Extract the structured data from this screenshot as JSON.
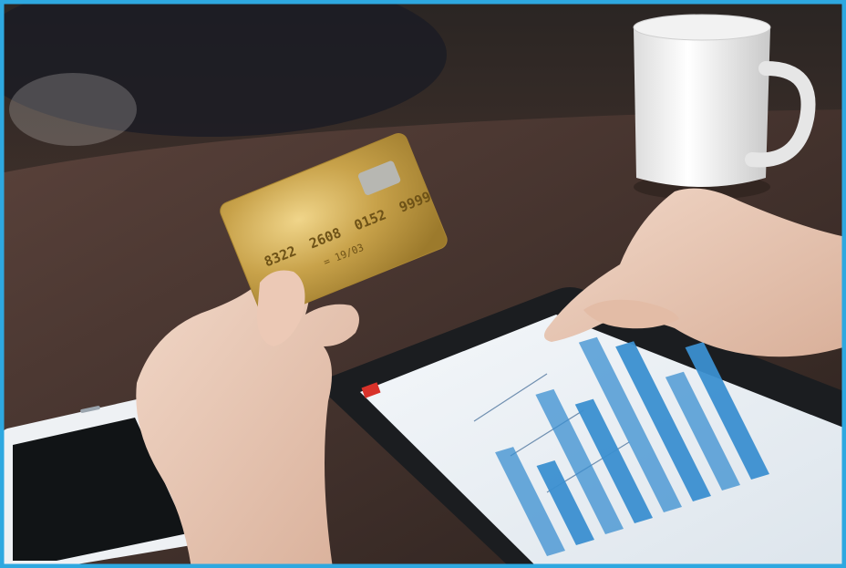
{
  "photo": {
    "frame_color": "#2ea8e0",
    "card": {
      "number_groups": [
        "8322",
        "2608",
        "0152",
        "9999"
      ],
      "expiry_label": "= 19/03",
      "color": "#c8a24a"
    },
    "tablet_chart": {
      "bar_levels": [
        0.55,
        0.42,
        0.74,
        0.63,
        0.9,
        0.82,
        0.6,
        0.7
      ],
      "bar_color": "#3b8fd0"
    }
  }
}
